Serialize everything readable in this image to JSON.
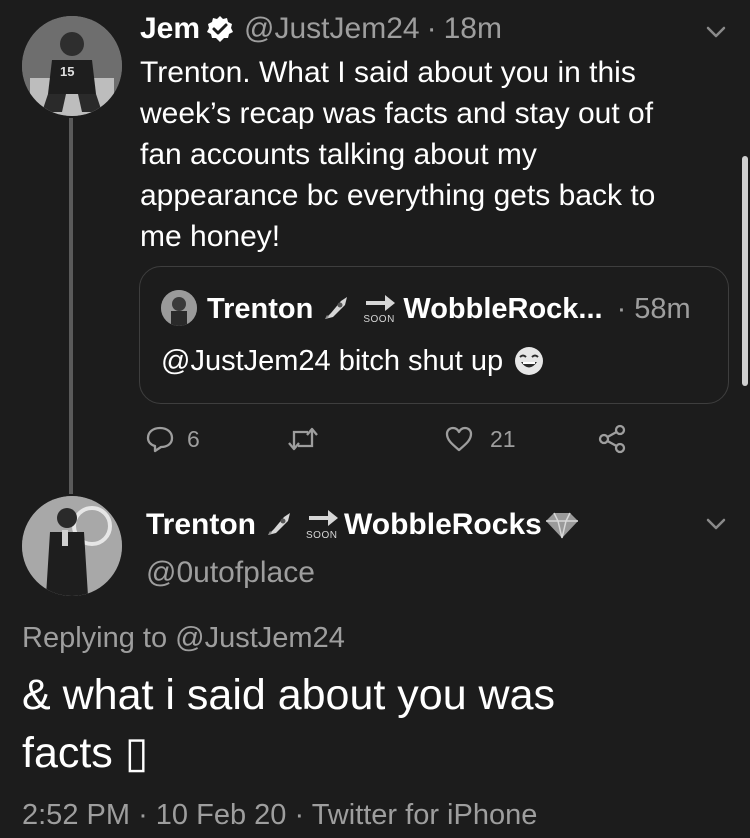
{
  "tweet": {
    "name": "Jem",
    "handle": "@JustJem24",
    "separator": "·",
    "time": "18m",
    "text_lines": [
      "Trenton. What I said about you in this",
      "week’s recap was facts and stay out of",
      "fan accounts talking about my",
      "appearance bc everything gets back to",
      "me honey!"
    ],
    "avatar_jersey": "15",
    "quote": {
      "name": "Trenton",
      "soon": "SOON",
      "name_rest": "WobbleRock...",
      "separator": "·",
      "time": "58m",
      "text": "@JustJem24 bitch shut up"
    },
    "actions": {
      "replies": "6",
      "retweets": "",
      "likes": "21"
    }
  },
  "reply": {
    "name": "Trenton",
    "soon": "SOON",
    "name_rest": "WobbleRocks",
    "handle": "@0utofplace",
    "replying_prefix": "Replying to ",
    "replying_handle": "@JustJem24",
    "text_lines": [
      "& what i said about you was",
      "facts ▯"
    ],
    "time": "2:52 PM",
    "separator1": "·",
    "date": "10 Feb 20",
    "separator2": "·",
    "source": "Twitter for iPhone"
  },
  "colors": {
    "background": "#1c1c1c",
    "text": "#ffffff",
    "muted": "#9e9e9e",
    "border": "#3e3e3e"
  }
}
